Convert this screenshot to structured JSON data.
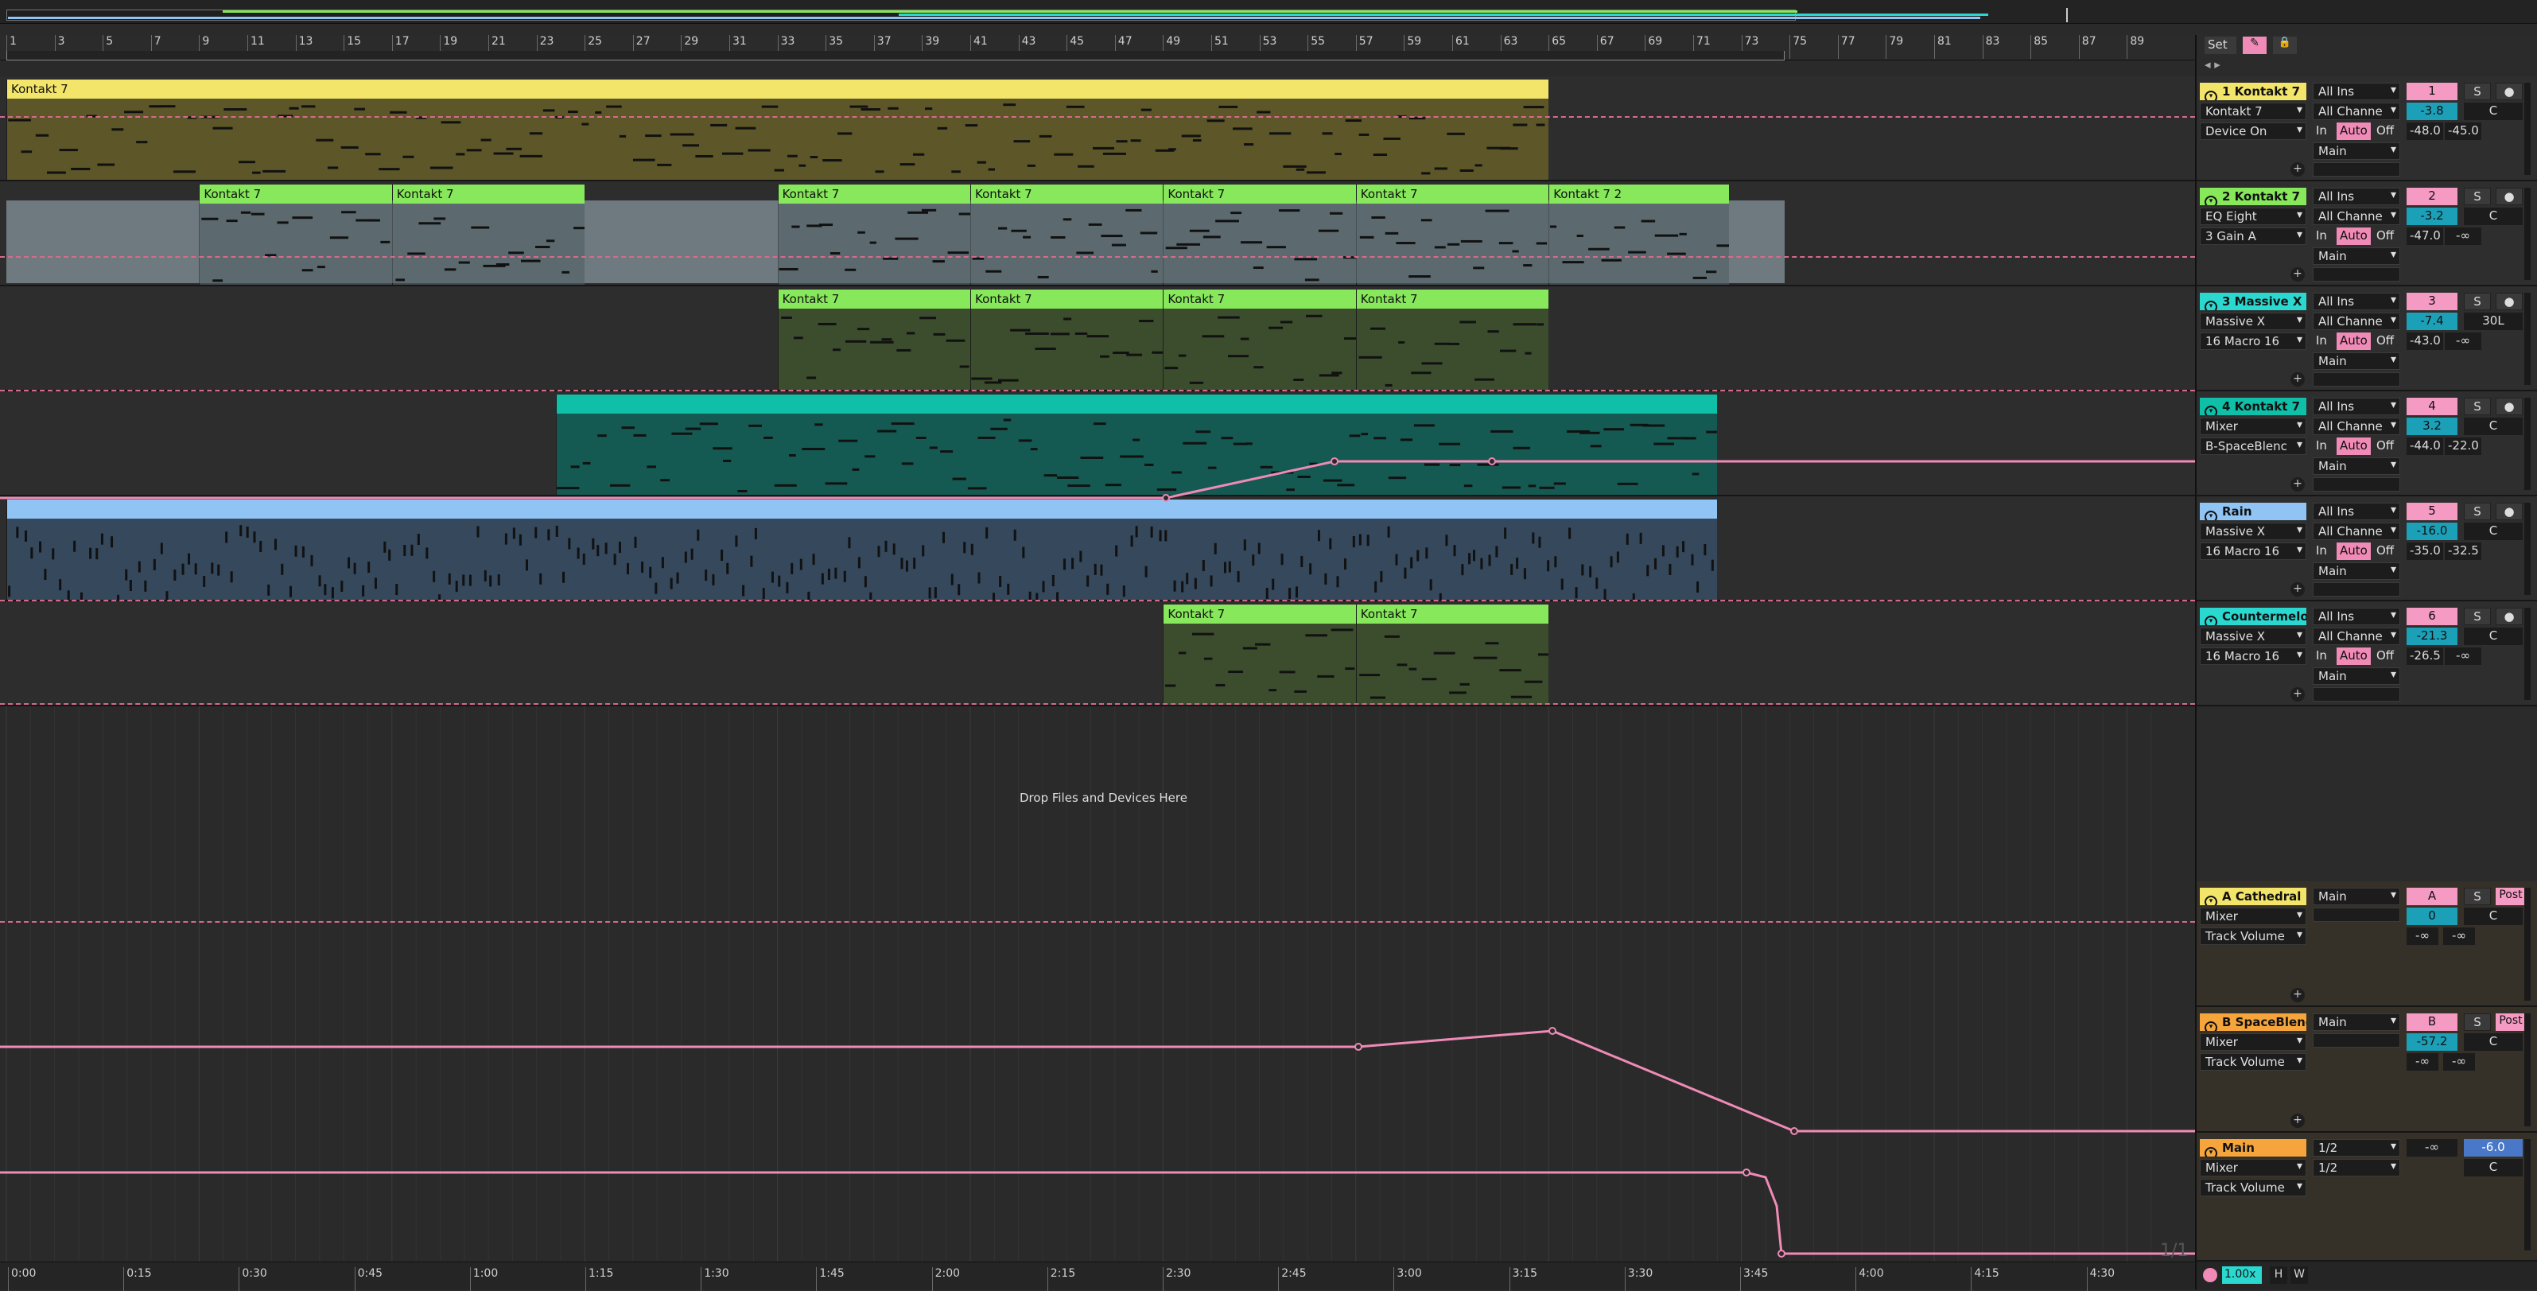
{
  "colors": {
    "yellow": "#f3e569",
    "green": "#86e85a",
    "cyan": "#2ad8d0",
    "teal": "#0fbfa8",
    "blue": "#8fc4f5",
    "orange": "#f5a53c",
    "pink": "#f08ab6",
    "automation": "#f08ab6"
  },
  "ruler": {
    "bars": [
      "1",
      "3",
      "5",
      "7",
      "9",
      "11",
      "13",
      "15",
      "17",
      "19",
      "21",
      "23",
      "25",
      "27",
      "29",
      "31",
      "33",
      "35",
      "37",
      "39",
      "41",
      "43",
      "45",
      "47",
      "49",
      "51",
      "53",
      "55",
      "57",
      "59",
      "61",
      "63",
      "65",
      "67",
      "69",
      "71",
      "73",
      "75",
      "77",
      "79",
      "81",
      "83",
      "85",
      "87",
      "89"
    ]
  },
  "timeline": {
    "labels": [
      "0:00",
      "0:15",
      "0:30",
      "0:45",
      "1:00",
      "1:15",
      "1:30",
      "1:45",
      "2:00",
      "2:15",
      "2:30",
      "2:45",
      "3:00",
      "3:15",
      "3:30",
      "3:45",
      "4:00",
      "4:15",
      "4:30"
    ]
  },
  "arrangement": {
    "drop_hint": "Drop Files and Devices Here",
    "page_indicator": "1/1",
    "tracks": [
      {
        "clips": [
          {
            "label": "Kontakt 7",
            "start": 1,
            "end": 65,
            "color": "yellow"
          }
        ]
      },
      {
        "clips": [
          {
            "label": "Kontakt 7",
            "start": 9,
            "end": 17,
            "color": "green"
          },
          {
            "label": "Kontakt 7",
            "start": 17,
            "end": 25,
            "color": "green"
          },
          {
            "label": "Kontakt 7",
            "start": 33,
            "end": 41,
            "color": "green"
          },
          {
            "label": "Kontakt 7",
            "start": 41,
            "end": 49,
            "color": "green"
          },
          {
            "label": "Kontakt 7",
            "start": 49,
            "end": 57,
            "color": "green"
          },
          {
            "label": "Kontakt 7",
            "start": 57,
            "end": 65,
            "color": "green"
          },
          {
            "label": "Kontakt 7 2",
            "start": 65,
            "end": 72.5,
            "color": "green"
          }
        ]
      },
      {
        "clips": [
          {
            "label": "Kontakt 7",
            "start": 33,
            "end": 41,
            "color": "green"
          },
          {
            "label": "Kontakt 7",
            "start": 41,
            "end": 49,
            "color": "green"
          },
          {
            "label": "Kontakt 7",
            "start": 49,
            "end": 57,
            "color": "green"
          },
          {
            "label": "Kontakt 7",
            "start": 57,
            "end": 65,
            "color": "green"
          }
        ]
      },
      {
        "clips": [
          {
            "label": "",
            "start": 23.8,
            "end": 72,
            "color": "teal"
          }
        ]
      },
      {
        "clips": [
          {
            "label": "",
            "start": 1,
            "end": 72,
            "color": "blue"
          }
        ]
      },
      {
        "clips": [
          {
            "label": "Kontakt 7",
            "start": 49,
            "end": 57,
            "color": "green"
          },
          {
            "label": "Kontakt 7",
            "start": 57,
            "end": 65,
            "color": "green"
          }
        ]
      }
    ]
  },
  "mixer": {
    "tracks": [
      {
        "name": "1 Kontakt 7",
        "color": "yellow",
        "device1": "Kontakt 7",
        "device2": "Device On",
        "input": "All Ins",
        "channel": "All Channe",
        "output": "Main",
        "number": "1",
        "volume": "-3.8",
        "pan": "C",
        "send_a": "-48.0",
        "send_b": "-45.0",
        "mon_in": "In",
        "mon_auto": "Auto",
        "mon_off": "Off",
        "solo": "S"
      },
      {
        "name": "2 Kontakt 7",
        "color": "green",
        "device1": "EQ Eight",
        "device2": "3 Gain A",
        "input": "All Ins",
        "channel": "All Channe",
        "output": "Main",
        "number": "2",
        "volume": "-3.2",
        "pan": "C",
        "send_a": "-47.0",
        "send_b": "-∞",
        "mon_in": "In",
        "mon_auto": "Auto",
        "mon_off": "Off",
        "solo": "S"
      },
      {
        "name": "3 Massive X",
        "color": "cyan",
        "device1": "Massive X",
        "device2": "16 Macro 16",
        "input": "All Ins",
        "channel": "All Channe",
        "output": "Main",
        "number": "3",
        "volume": "-7.4",
        "pan": "30L",
        "send_a": "-43.0",
        "send_b": "-∞",
        "mon_in": "In",
        "mon_auto": "Auto",
        "mon_off": "Off",
        "solo": "S"
      },
      {
        "name": "4 Kontakt 7",
        "color": "teal",
        "device1": "Mixer",
        "device2": "B-SpaceBlenc",
        "input": "All Ins",
        "channel": "All Channe",
        "output": "Main",
        "number": "4",
        "volume": "3.2",
        "pan": "C",
        "send_a": "-44.0",
        "send_b": "-22.0",
        "mon_in": "In",
        "mon_auto": "Auto",
        "mon_off": "Off",
        "solo": "S"
      },
      {
        "name": "Rain",
        "color": "blue",
        "device1": "Massive X",
        "device2": "16 Macro 16",
        "input": "All Ins",
        "channel": "All Channe",
        "output": "Main",
        "number": "5",
        "volume": "-16.0",
        "pan": "C",
        "send_a": "-35.0",
        "send_b": "-32.5",
        "mon_in": "In",
        "mon_auto": "Auto",
        "mon_off": "Off",
        "solo": "S"
      },
      {
        "name": "Countermelo",
        "color": "cyan",
        "device1": "Massive X",
        "device2": "16 Macro 16",
        "input": "All Ins",
        "channel": "All Channe",
        "output": "Main",
        "number": "6",
        "volume": "-21.3",
        "pan": "C",
        "send_a": "-26.5",
        "send_b": "-∞",
        "mon_in": "In",
        "mon_auto": "Auto",
        "mon_off": "Off",
        "solo": "S"
      }
    ],
    "returns": [
      {
        "name": "A Cathedral",
        "color": "yellow",
        "device1": "Mixer",
        "device2": "Track Volume",
        "output": "Main",
        "number": "A",
        "volume": "0",
        "pan": "C",
        "send_a": "-∞",
        "send_b": "-∞",
        "solo": "S",
        "post": "Post"
      },
      {
        "name": "B SpaceBlend",
        "color": "orange",
        "device1": "Mixer",
        "device2": "Track Volume",
        "output": "Main",
        "number": "B",
        "volume": "-57.2",
        "pan": "C",
        "send_a": "-∞",
        "send_b": "-∞",
        "solo": "S",
        "post": "Post"
      }
    ],
    "main": {
      "name": "Main",
      "color": "orange",
      "device1": "Mixer",
      "device2": "Track Volume",
      "cue_out": "1/2",
      "main_out": "1/2",
      "volume_left": "-∞",
      "volume": "-6.0",
      "pan": "C"
    }
  },
  "toolbar": {
    "set_label": "Set",
    "zoom": "1.00x",
    "h_label": "H",
    "w_label": "W"
  }
}
